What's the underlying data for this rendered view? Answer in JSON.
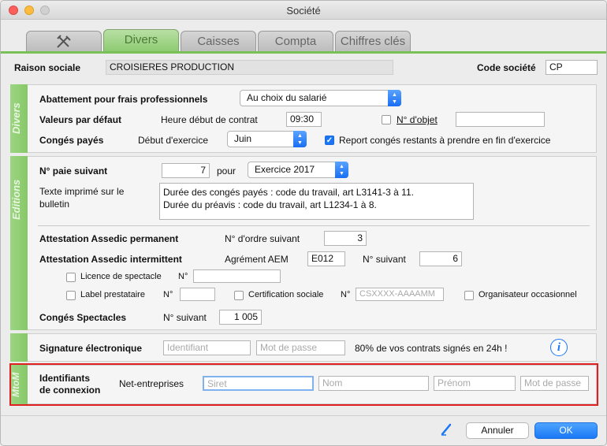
{
  "window": {
    "title": "Société"
  },
  "tabs": [
    {
      "label": "",
      "icon": "tools-icon"
    },
    {
      "label": "Divers",
      "active": true
    },
    {
      "label": "Caisses"
    },
    {
      "label": "Compta"
    },
    {
      "label": "Chiffres clés"
    }
  ],
  "header": {
    "raison_label": "Raison sociale",
    "raison_value": "CROISIERES PRODUCTION",
    "code_label": "Code société",
    "code_value": "CP"
  },
  "divers": {
    "side_label": "Divers",
    "abattement_label": "Abattement pour frais professionnels",
    "abattement_value": "Au choix du salarié",
    "defaut_label": "Valeurs par défaut",
    "heure_label": "Heure début de contrat",
    "heure_value": "09:30",
    "objet_label": "N° d'objet",
    "objet_value": "",
    "conges_label": "Congés payés",
    "debut_label": "Début d'exercice",
    "debut_value": "Juin",
    "report_label": "Report congés restants à prendre en fin d'exercice"
  },
  "editions": {
    "side_label": "Editions",
    "paie_label": "N° paie suivant",
    "paie_value": "7",
    "pour_label": "pour",
    "exercice_value": "Exercice 2017",
    "texte_label": "Texte imprimé sur le bulletin",
    "texte_line1": "Durée des congés payés : code du travail, art L3141-3 à 11.",
    "texte_line2": "Durée du préavis : code du travail, art L1234-1 à 8.",
    "assedic_perm_label": "Attestation Assedic permanent",
    "ordre_label": "N° d'ordre suivant",
    "ordre_value": "3",
    "assedic_int_label": "Attestation Assedic intermittent",
    "agrement_label": "Agrément AEM",
    "agrement_value": "E012",
    "nsuivant_label": "N° suivant",
    "nsuivant_value": "6",
    "licence_label": "Licence de spectacle",
    "licence_no_label": "N°",
    "label_prest_label": "Label prestataire",
    "label_no_label": "N°",
    "certif_label": "Certification sociale",
    "certif_no_label": "N°",
    "certif_placeholder": "CSXXXX-AAAAMM",
    "organisateur_label": "Organisateur occasionnel",
    "spectacles_label": "Congés Spectacles",
    "spect_nsuivant_label": "N° suivant",
    "spect_value": "1 005"
  },
  "signature": {
    "label": "Signature électronique",
    "identifiant_placeholder": "Identifiant",
    "mdp_placeholder": "Mot de passe",
    "promo": "80% de vos contrats signés en 24h !",
    "info_icon": "info-icon"
  },
  "mtom": {
    "side_label": "MtoM",
    "ident_line1": "Identifiants",
    "ident_line2": "de connexion",
    "net_label": "Net-entreprises",
    "siret_placeholder": "Siret",
    "nom_placeholder": "Nom",
    "prenom_placeholder": "Prénom",
    "mdp_placeholder": "Mot de passe"
  },
  "footer": {
    "cancel_label": "Annuler",
    "ok_label": "OK",
    "pen_icon": "pen-icon"
  },
  "colors": {
    "accent_green": "#8ecb72",
    "highlight_red": "#e02020",
    "blue": "#1a76f5"
  }
}
